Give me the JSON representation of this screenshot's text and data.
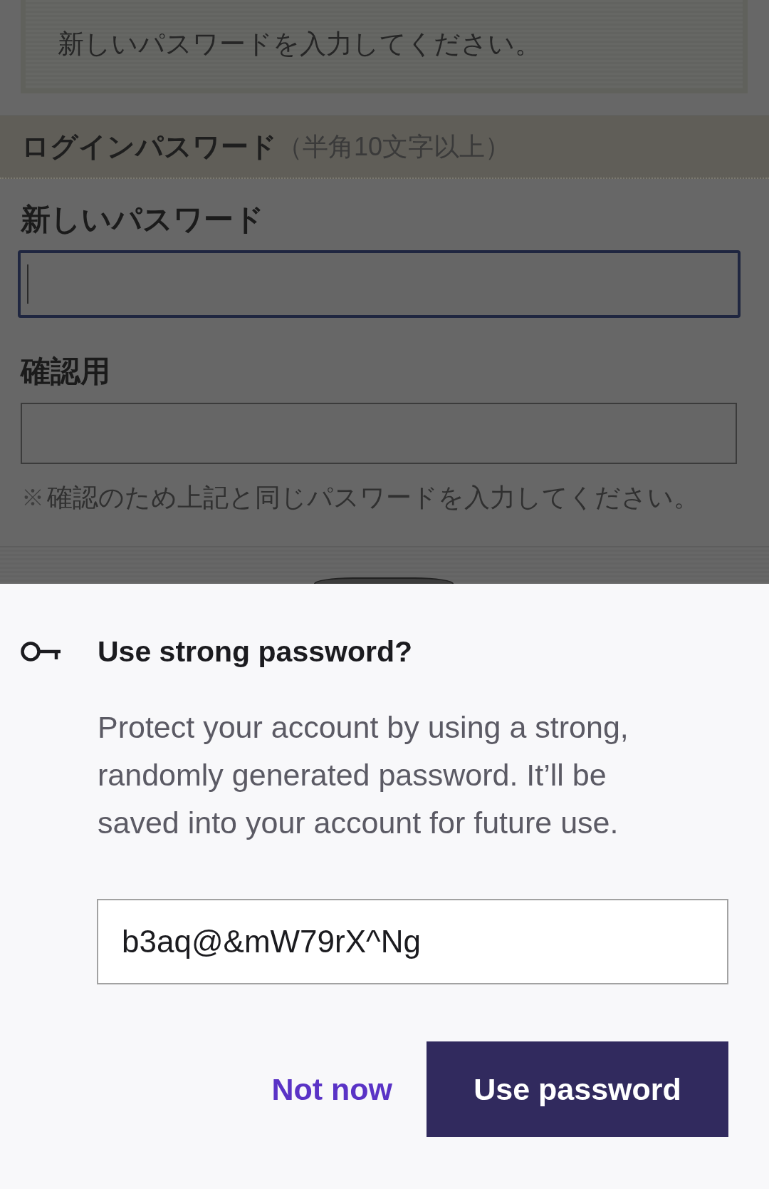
{
  "notice": {
    "text": "新しいパスワードを入力してください。"
  },
  "section": {
    "title": "ログインパスワード",
    "hint": "（半角10文字以上）"
  },
  "fields": [
    {
      "label": "新しいパスワード",
      "focused": true
    },
    {
      "label": "確認用",
      "focused": false
    }
  ],
  "note": {
    "mark": "※",
    "text": "確認のため上記と同じパスワードを入力してください。"
  },
  "dialog": {
    "title": "Use strong password?",
    "body": "Protect your account by using a strong, randomly generated password. It’ll be saved into your account for future use.",
    "password": "b3aq@&mW79rX^Ng",
    "buttons": [
      {
        "label": "Not now",
        "kind": "text"
      },
      {
        "label": "Use password",
        "kind": "filled"
      }
    ]
  }
}
